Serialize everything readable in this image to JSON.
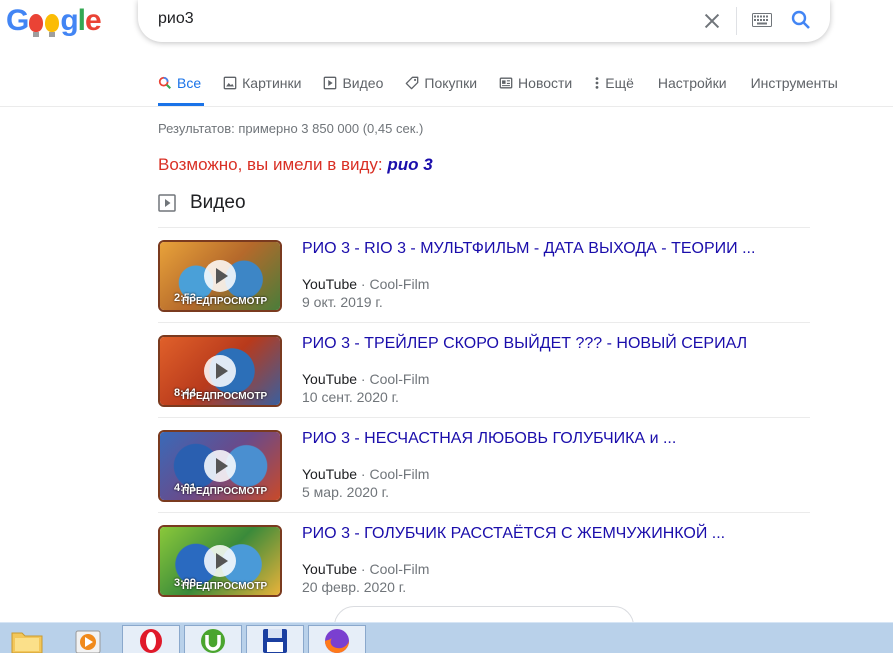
{
  "search": {
    "query": "рио3"
  },
  "tabs": [
    {
      "label": "Все",
      "icon": "search-icon"
    },
    {
      "label": "Картинки",
      "icon": "image-icon"
    },
    {
      "label": "Видео",
      "icon": "video-play-icon"
    },
    {
      "label": "Покупки",
      "icon": "tag-icon"
    },
    {
      "label": "Новости",
      "icon": "news-icon"
    },
    {
      "label": "Ещё",
      "icon": "more-vert-icon"
    },
    {
      "label": "Настройки"
    },
    {
      "label": "Инструменты"
    }
  ],
  "stats": "Результатов: примерно 3 850 000 (0,45 сек.)",
  "spell": {
    "prefix": "Возможно, вы имели в виду: ",
    "suggestion": "рио 3"
  },
  "videos_heading": "Видео",
  "preview_label": "ПРЕДПРОСМОТР",
  "videos": [
    {
      "title": "РИО 3 - RIO 3 - МУЛЬТФИЛЬМ - ДАТА ВЫХОДА - ТЕОРИИ ...",
      "source": "YouTube",
      "channel": "Cool-Film",
      "date": "9 окт. 2019 г.",
      "duration": "2:53"
    },
    {
      "title": "РИО 3 - ТРЕЙЛЕР СКОРО ВЫЙДЕТ ??? - НОВЫЙ СЕРИАЛ",
      "source": "YouTube",
      "channel": "Cool-Film",
      "date": "10 сент. 2020 г.",
      "duration": "8:44"
    },
    {
      "title": "РИО 3 - НЕСЧАСТНАЯ ЛЮБОВЬ ГОЛУБЧИКА и ...",
      "source": "YouTube",
      "channel": "Cool-Film",
      "date": "5 мар. 2020 г.",
      "duration": "4:01"
    },
    {
      "title": "РИО 3 - ГОЛУБЧИК РАССТАЁТСЯ С ЖЕМЧУЖИНКОЙ ...",
      "source": "YouTube",
      "channel": "Cool-Film",
      "date": "20 февр. 2020 г.",
      "duration": "3:09"
    }
  ],
  "colors": {
    "accent": "#1a73e8",
    "link": "#1a0dab",
    "spell_red": "#d93025"
  }
}
